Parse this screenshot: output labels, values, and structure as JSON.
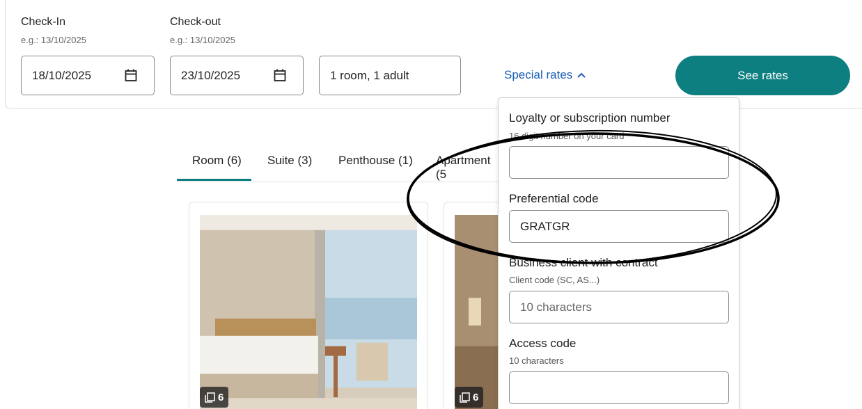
{
  "search": {
    "checkin_label": "Check-In",
    "checkin_hint": "e.g.: 13/10/2025",
    "checkin_value": "18/10/2025",
    "checkout_label": "Check-out",
    "checkout_hint": "e.g.: 13/10/2025",
    "checkout_value": "23/10/2025",
    "guests_value": "1 room, 1 adult",
    "special_rates_label": "Special rates",
    "see_rates_label": "See rates"
  },
  "tabs": [
    {
      "label": "Room (6)",
      "active": true
    },
    {
      "label": "Suite (3)",
      "active": false
    },
    {
      "label": "Penthouse (1)",
      "active": false
    },
    {
      "label": "Apartment (5",
      "active": false
    }
  ],
  "cards": [
    {
      "photo_count": "6"
    },
    {
      "photo_count": "6"
    }
  ],
  "special_rates": {
    "loyalty_label": "Loyalty or subscription number",
    "loyalty_hint": "16 digit number on your card",
    "loyalty_value": "",
    "preferential_label": "Preferential code",
    "preferential_value": "GRATGR",
    "business_label": "Business client with contract",
    "business_hint": "Client code (SC, AS...)",
    "business_placeholder": "10 characters",
    "access_label": "Access code",
    "access_hint": "10 characters",
    "access_value": ""
  },
  "colors": {
    "accent": "#0e7f80",
    "link": "#1a5fb4",
    "annotation": "#000000"
  },
  "icons": [
    "calendar-icon",
    "chevron-up-icon",
    "photo-gallery-icon"
  ]
}
